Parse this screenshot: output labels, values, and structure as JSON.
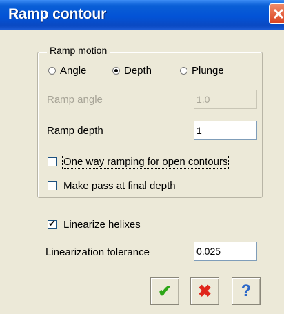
{
  "window": {
    "title": "Ramp contour"
  },
  "ramp_motion": {
    "legend": "Ramp motion",
    "options": [
      {
        "label": "Angle",
        "selected": false
      },
      {
        "label": "Depth",
        "selected": true
      },
      {
        "label": "Plunge",
        "selected": false
      }
    ]
  },
  "ramp_angle": {
    "label": "Ramp angle",
    "value": "1.0",
    "enabled": false
  },
  "ramp_depth": {
    "label": "Ramp depth",
    "value": "1"
  },
  "one_way": {
    "label": "One way ramping for open contours",
    "checked": false
  },
  "final_pass": {
    "label": "Make pass at final depth",
    "checked": false
  },
  "linearize": {
    "label": "Linearize helixes",
    "checked": true
  },
  "tolerance": {
    "label": "Linearization tolerance",
    "value": "0.025"
  },
  "buttons": {
    "ok": "✔",
    "cancel": "✖",
    "help": "?"
  }
}
